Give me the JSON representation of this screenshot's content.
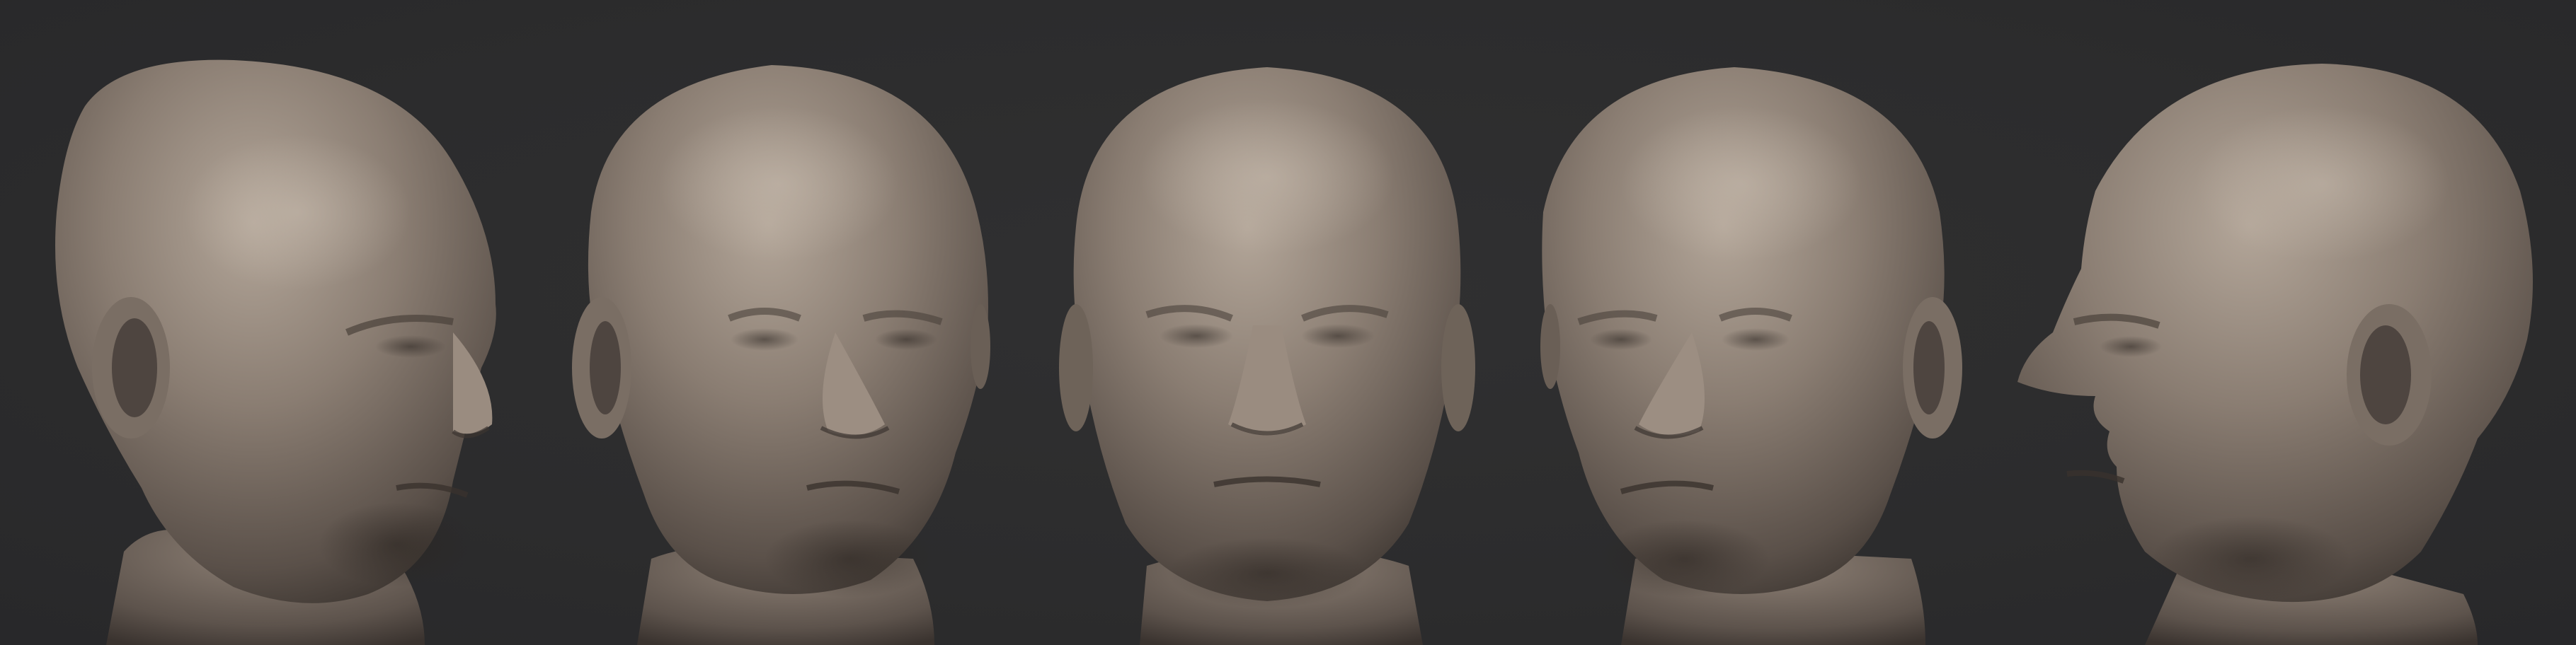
{
  "scene": {
    "background_color": "#2c2c2d",
    "clay_color": "#8a7d72",
    "clay_shadow": "#3e3732",
    "clay_highlight": "#b3a699",
    "views": [
      {
        "name": "three-quarter-right",
        "facing": "right"
      },
      {
        "name": "slight-right",
        "facing": "slight-right"
      },
      {
        "name": "front",
        "facing": "front"
      },
      {
        "name": "slight-left",
        "facing": "slight-left"
      },
      {
        "name": "profile-left",
        "facing": "left"
      }
    ]
  }
}
